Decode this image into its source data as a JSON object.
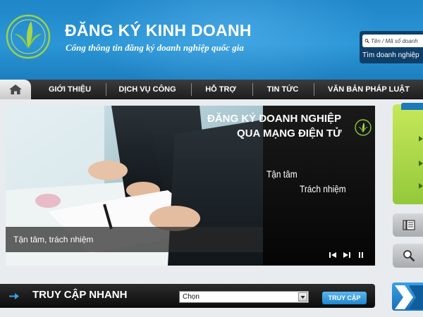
{
  "header": {
    "title": "ĐĂNG KÝ KINH DOANH",
    "subtitle": "Cổng thông tin đăng ký doanh nghiệp quốc gia",
    "search": {
      "placeholder": "Tên / Mã số doanh",
      "label": "Tìm doanh nghiệp"
    }
  },
  "nav": {
    "items": [
      {
        "label": "GIỚI THIỆU"
      },
      {
        "label": "DỊCH VỤ CÔNG"
      },
      {
        "label": "HỖ TRỢ"
      },
      {
        "label": "TIN TỨC"
      },
      {
        "label": "VĂN BẢN PHÁP LUẬT"
      }
    ]
  },
  "banner": {
    "title_line1": "ĐĂNG KÝ DOANH NGHIỆP",
    "title_line2": "QUA MẠNG ĐIỆN TỬ",
    "slogan1": "Tận tâm",
    "slogan2": "Trách nhiệm",
    "caption": "Tận tâm, trách nhiệm"
  },
  "quick_access": {
    "title": "TRUY CẬP NHANH",
    "select_value": "Chọn",
    "button_label": "TRUY CẬP"
  },
  "colors": {
    "header_blue": "#2b96d6",
    "nav_dark": "#1e1e1e",
    "accent_green": "#94c93b",
    "button_blue": "#1f86cf"
  }
}
